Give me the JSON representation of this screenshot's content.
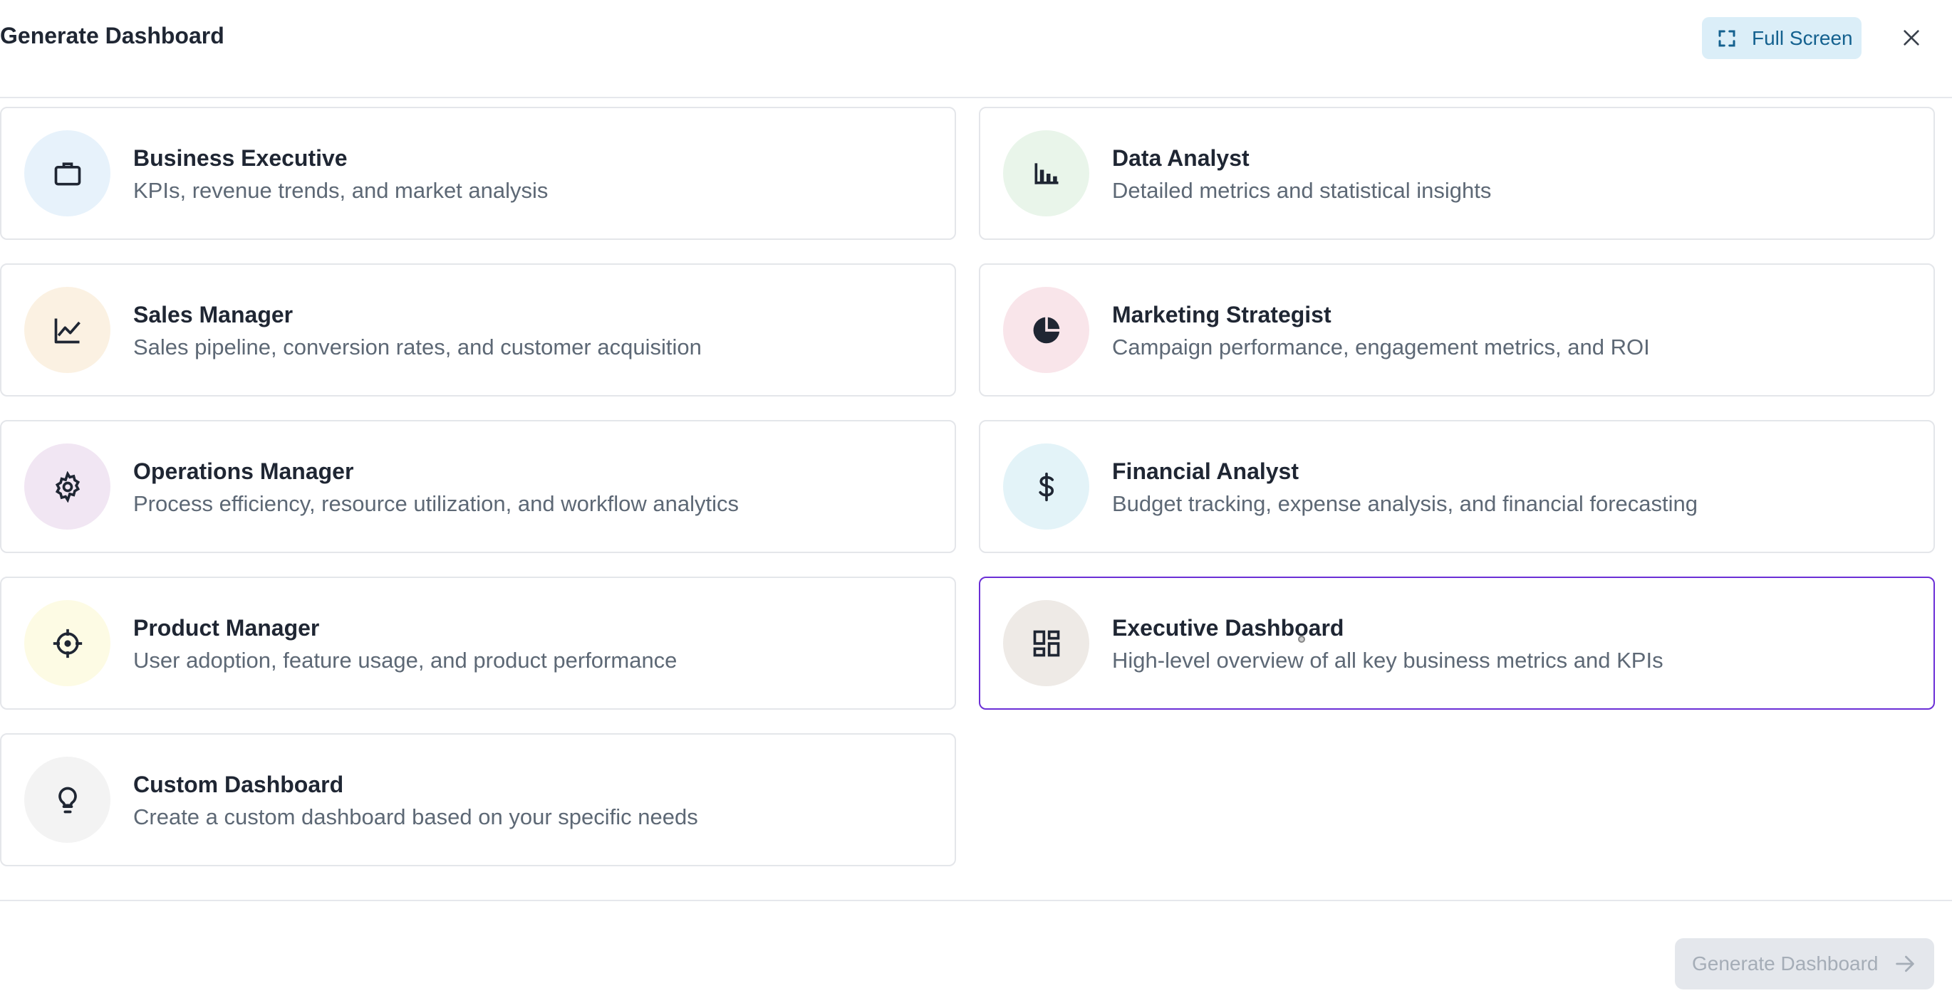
{
  "header": {
    "title": "Generate Dashboard",
    "fullscreen_label": "Full Screen"
  },
  "cards": [
    {
      "title": "Business Executive",
      "desc": "KPIs, revenue trends, and market analysis",
      "icon": "briefcase-icon",
      "bg": "#e7f2fb"
    },
    {
      "title": "Data Analyst",
      "desc": "Detailed metrics and statistical insights",
      "icon": "bar-chart-icon",
      "bg": "#e9f5ea"
    },
    {
      "title": "Sales Manager",
      "desc": "Sales pipeline, conversion rates, and customer acquisition",
      "icon": "line-chart-icon",
      "bg": "#fbf1e2"
    },
    {
      "title": "Marketing Strategist",
      "desc": "Campaign performance, engagement metrics, and ROI",
      "icon": "pie-chart-icon",
      "bg": "#f9e5ea"
    },
    {
      "title": "Operations Manager",
      "desc": "Process efficiency, resource utilization, and workflow analytics",
      "icon": "gear-icon",
      "bg": "#f1e6f3"
    },
    {
      "title": "Financial Analyst",
      "desc": "Budget tracking, expense analysis, and financial forecasting",
      "icon": "dollar-icon",
      "bg": "#e3f3f8"
    },
    {
      "title": "Product Manager",
      "desc": "User adoption, feature usage, and product performance",
      "icon": "crosshair-icon",
      "bg": "#fdfbe4"
    },
    {
      "title": "Executive Dashboard",
      "desc": "High-level overview of all key business metrics and KPIs",
      "icon": "dashboard-icon",
      "bg": "#eeeae6",
      "selected": true
    },
    {
      "title": "Custom Dashboard",
      "desc": "Create a custom dashboard based on your specific needs",
      "icon": "lightbulb-icon",
      "bg": "#f3f3f3"
    }
  ],
  "footer": {
    "generate_label": "Generate Dashboard"
  },
  "colors": {
    "accent_selected": "#6b2fd6",
    "fullscreen_bg": "#dbeef8",
    "fullscreen_text": "#14618f",
    "disabled_bg": "#e4e7ec",
    "disabled_text": "#a5adb7"
  }
}
